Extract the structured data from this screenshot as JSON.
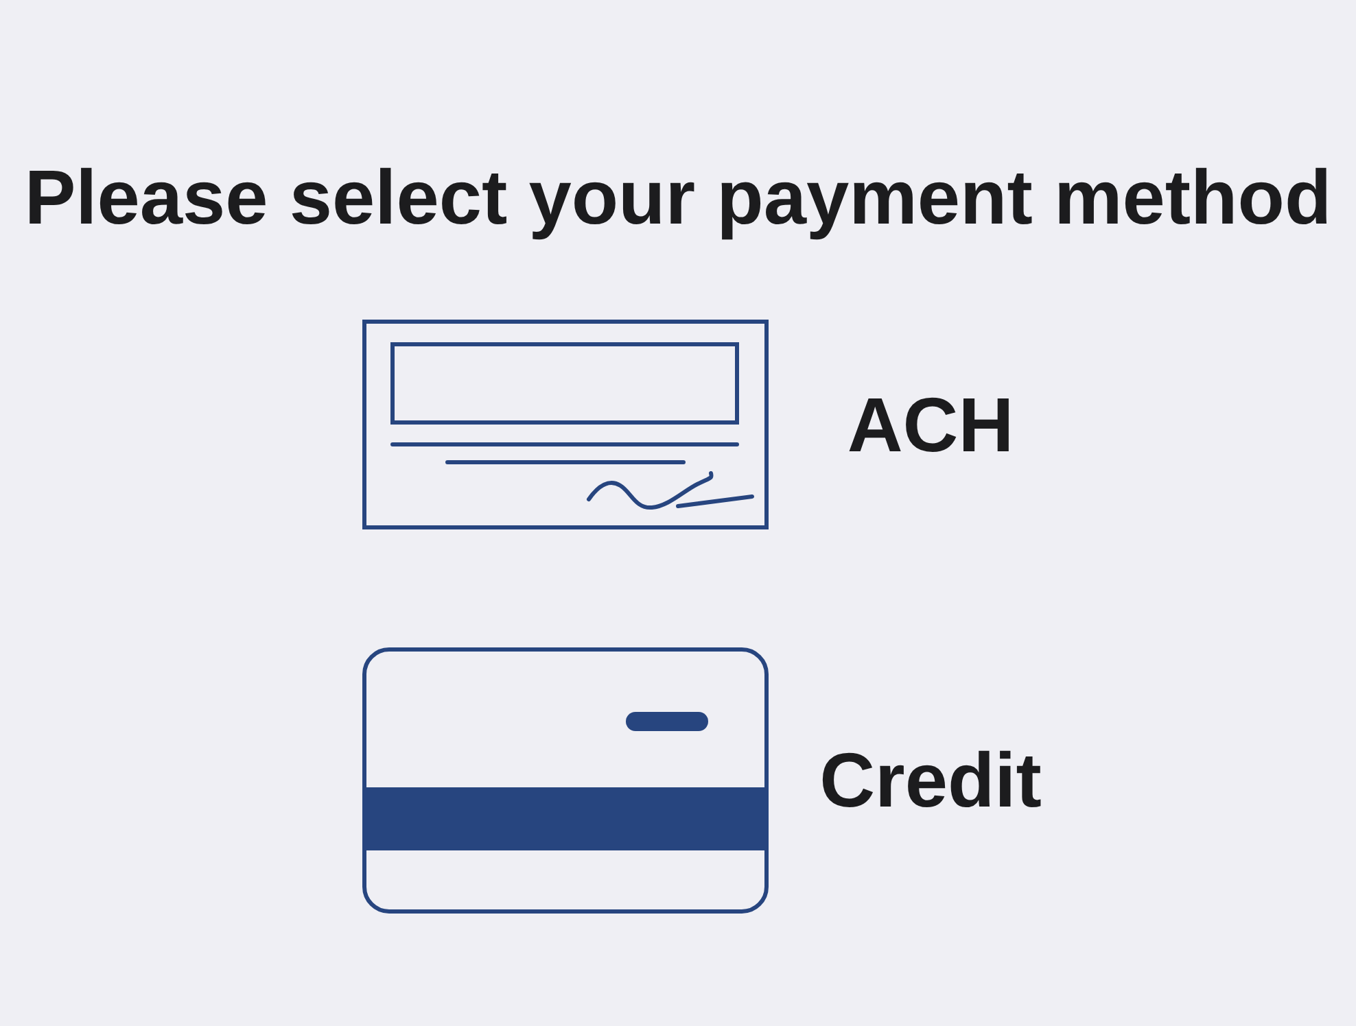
{
  "title": "Please select your payment method",
  "payment_methods": [
    {
      "kind": "check",
      "label": "ACH"
    },
    {
      "kind": "card",
      "label": "Credit"
    }
  ]
}
